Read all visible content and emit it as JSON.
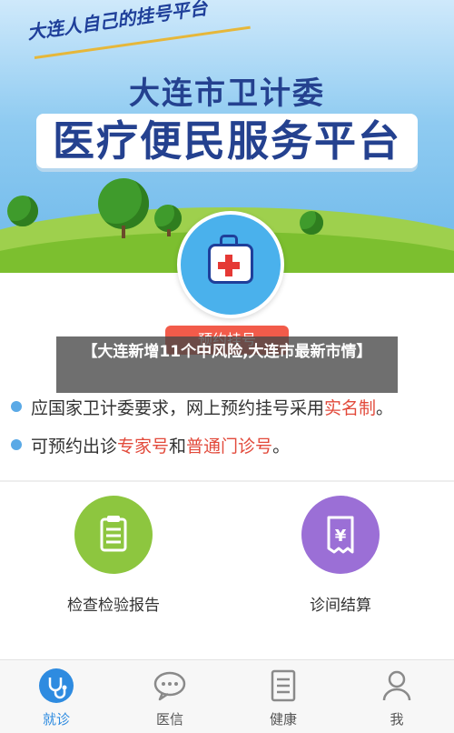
{
  "banner": {
    "slogan": "大连人自己的挂号平台",
    "org_title": "大连市卫计委",
    "platform_title": "医疗便民服务平台",
    "book_button": "预约挂号"
  },
  "overlay": {
    "headline": "【大连新增11个中风险,大连市最新市情】"
  },
  "notices": [
    {
      "prefix": "应国家卫计委要求，网上预约挂号采用",
      "highlight": "实名制",
      "suffix": "。"
    },
    {
      "prefix": "可预约出诊",
      "highlight1": "专家号",
      "middle": "和",
      "highlight2": "普通门诊号",
      "suffix": "。"
    }
  ],
  "services": [
    {
      "label": "检查检验报告",
      "icon": "clipboard-icon",
      "color": "#8dc63f"
    },
    {
      "label": "诊间结算",
      "icon": "bill-yen-icon",
      "color": "#9b6fd6"
    }
  ],
  "tabbar": {
    "items": [
      {
        "label": "就诊",
        "icon": "stethoscope-icon",
        "active": true
      },
      {
        "label": "医信",
        "icon": "chat-icon",
        "active": false
      },
      {
        "label": "健康",
        "icon": "document-icon",
        "active": false
      },
      {
        "label": "我",
        "icon": "user-icon",
        "active": false
      }
    ]
  },
  "colors": {
    "accent_blue": "#2e8be0",
    "highlight_red": "#e24a3b",
    "brand_navy": "#24418f"
  }
}
